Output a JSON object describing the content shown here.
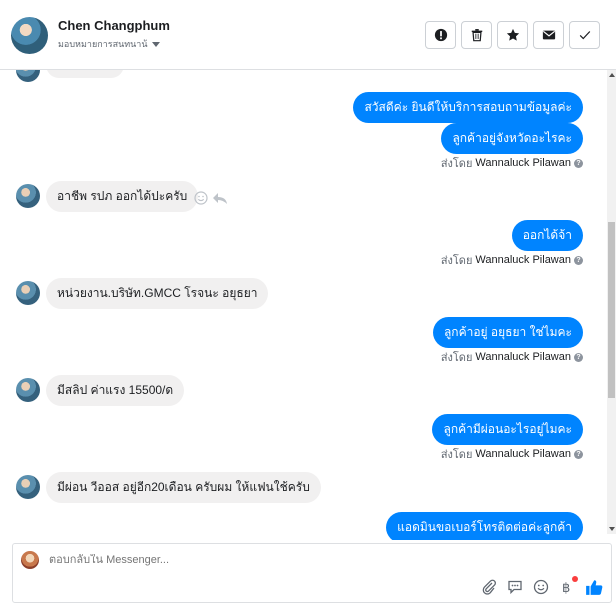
{
  "header": {
    "name": "Chen Changphum",
    "assign": "มอบหมายการสนทนาน้"
  },
  "messages": {
    "out1": "สวัสดีค่ะ  ยินดีให้บริการสอบถามข้อมูลค่ะ",
    "out2": "ลูกค้าอยู่จังหวัดอะไรคะ",
    "in1": "อาชีพ รปภ ออกได้ปะครับ",
    "out3": "ออกได้จ้า",
    "in2": "หน่วยงาน.บริษัท.GMCC โรจนะ อยุธยา",
    "out4": "ลูกค้าอยู่ อยุธยา  ใช่ไมคะ",
    "in3": "มีสลิป ค่าแรง 15500/ด",
    "out5": "ลูกค้ามีผ่อนอะไรอยู่ไมคะ",
    "in4": "มีผ่อน วีออส อยู่อีก20เดือน ครับผม ให้แฟนใช้ครับ",
    "out6": "แอดมินขอเบอร์โทรติดต่อค่ะลูกค้า"
  },
  "sent_by": {
    "prefix": "ส่งโดย",
    "name": "Wannaluck Pilawan"
  },
  "composer": {
    "placeholder": "ตอบกลับใน Messenger..."
  },
  "icons": {
    "spam": "exclamation-icon",
    "trash": "trash-icon",
    "star": "star-icon",
    "mail": "envelope-icon",
    "done": "check-icon"
  },
  "colors": {
    "outgoing": "#0084ff",
    "incoming": "#f1f0f0",
    "like": "#0084ff"
  }
}
